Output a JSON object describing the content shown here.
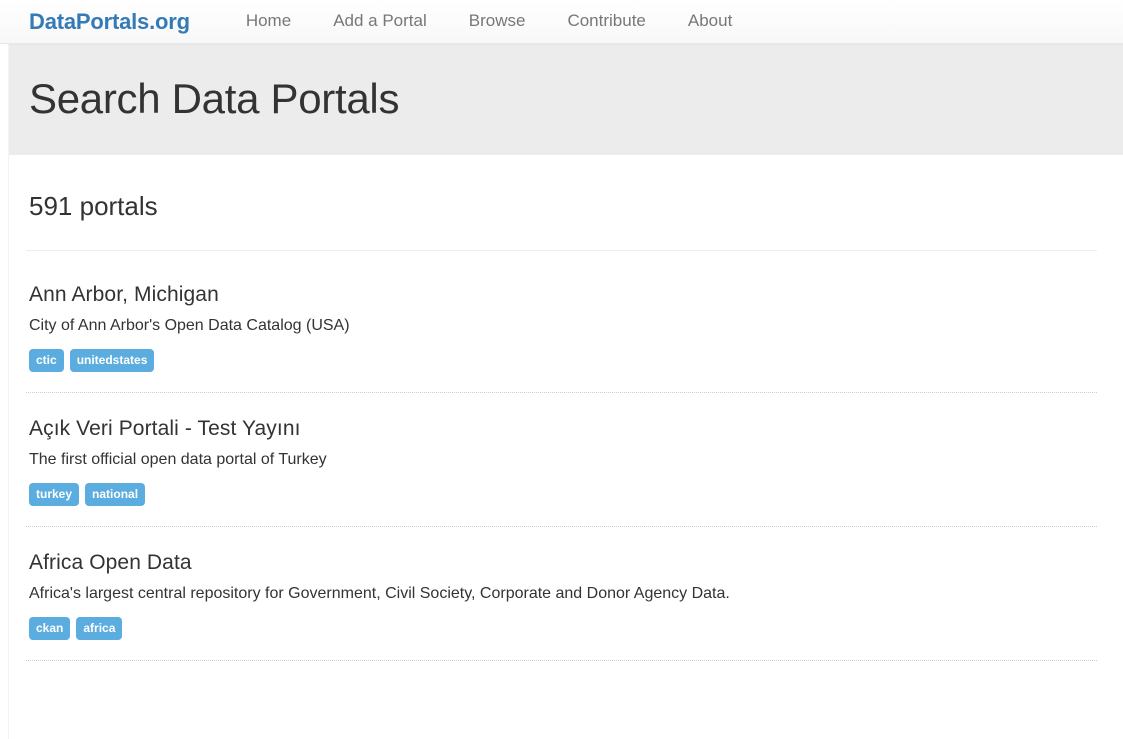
{
  "site": {
    "brand": "DataPortals.org",
    "brand_color": "#337ab7",
    "tag_color": "#5bacdf",
    "hero_bg": "#ececec"
  },
  "nav": {
    "items": [
      {
        "label": "Home"
      },
      {
        "label": "Add a Portal"
      },
      {
        "label": "Browse"
      },
      {
        "label": "Contribute"
      },
      {
        "label": "About"
      }
    ]
  },
  "hero": {
    "title": "Search Data Portals"
  },
  "results": {
    "count_label": "591 portals",
    "portals": [
      {
        "title": "Ann Arbor, Michigan",
        "description": "City of Ann Arbor's Open Data Catalog (USA)",
        "tags": [
          "ctic",
          "unitedstates"
        ]
      },
      {
        "title": "Açık Veri Portali - Test Yayını",
        "description": "The first official open data portal of Turkey",
        "tags": [
          "turkey",
          "national"
        ]
      },
      {
        "title": "Africa Open Data",
        "description": "Africa's largest central repository for Government, Civil Society, Corporate and Donor Agency Data.",
        "tags": [
          "ckan",
          "africa"
        ]
      }
    ]
  }
}
